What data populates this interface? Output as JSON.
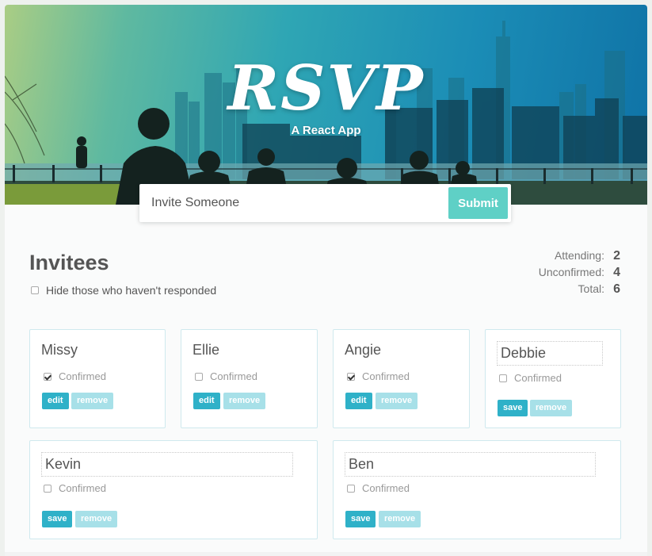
{
  "header": {
    "title": "RSVP",
    "subtitle": "A React App"
  },
  "invite_form": {
    "placeholder": "Invite Someone",
    "submit_label": "Submit"
  },
  "main": {
    "heading": "Invitees",
    "hide_filter": {
      "label": "Hide those who haven't responded",
      "checked": false
    }
  },
  "counter": {
    "attending_label": "Attending:",
    "attending": "2",
    "unconfirmed_label": "Unconfirmed:",
    "unconfirmed": "4",
    "total_label": "Total:",
    "total": "6"
  },
  "guests": [
    {
      "name": "Missy",
      "confirmed_label": "Confirmed",
      "confirmed": true,
      "editing": false,
      "edit_label": "edit",
      "remove_label": "remove"
    },
    {
      "name": "Ellie",
      "confirmed_label": "Confirmed",
      "confirmed": false,
      "editing": false,
      "edit_label": "edit",
      "remove_label": "remove"
    },
    {
      "name": "Angie",
      "confirmed_label": "Confirmed",
      "confirmed": true,
      "editing": false,
      "edit_label": "edit",
      "remove_label": "remove"
    },
    {
      "name": "Debbie",
      "confirmed_label": "Confirmed",
      "confirmed": false,
      "editing": true,
      "save_label": "save",
      "remove_label": "remove"
    },
    {
      "name": "Kevin",
      "confirmed_label": "Confirmed",
      "confirmed": false,
      "editing": true,
      "save_label": "save",
      "remove_label": "remove"
    },
    {
      "name": "Ben",
      "confirmed_label": "Confirmed",
      "confirmed": false,
      "editing": true,
      "save_label": "save",
      "remove_label": "remove"
    }
  ],
  "colors": {
    "accent": "#2fb1c8",
    "accent_light": "#a7e0e8",
    "submit": "#5fd0c6",
    "card_border": "#cfe9ee"
  }
}
